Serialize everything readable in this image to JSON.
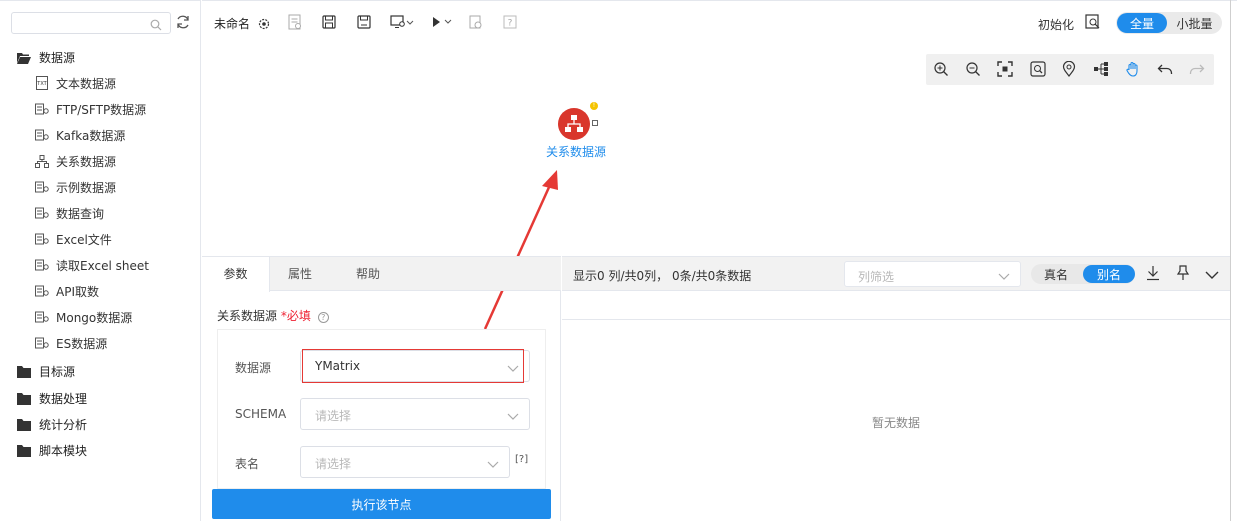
{
  "sidebar": {
    "search": {
      "placeholder": ""
    },
    "tree": {
      "datasource_group": "数据源",
      "datasource_items": [
        {
          "label": "文本数据源",
          "icon": "txt-file-icon"
        },
        {
          "label": "FTP/SFTP数据源",
          "icon": "database-link-icon"
        },
        {
          "label": "Kafka数据源",
          "icon": "database-link-icon"
        },
        {
          "label": "关系数据源",
          "icon": "relation-icon"
        },
        {
          "label": "示例数据源",
          "icon": "database-link-icon"
        },
        {
          "label": "数据查询",
          "icon": "database-link-icon"
        },
        {
          "label": "Excel文件",
          "icon": "database-link-icon"
        },
        {
          "label": "读取Excel sheet",
          "icon": "database-link-icon"
        },
        {
          "label": "API取数",
          "icon": "database-link-icon"
        },
        {
          "label": "Mongo数据源",
          "icon": "database-link-icon"
        },
        {
          "label": "ES数据源",
          "icon": "database-link-icon"
        }
      ],
      "other_groups": [
        "目标源",
        "数据处理",
        "统计分析",
        "脚本模块"
      ]
    }
  },
  "topbar": {
    "title": "未命名",
    "init_label": "初始化",
    "mode_full": "全量",
    "mode_small": "小批量"
  },
  "canvas": {
    "node_label": "关系数据源",
    "node_color": "#d9362c"
  },
  "param_panel": {
    "tabs": [
      "参数",
      "属性",
      "帮助"
    ],
    "section_title": "关系数据源",
    "required_mark": "*必填",
    "fields": {
      "datasource": {
        "label": "数据源",
        "value": "YMatrix"
      },
      "schema": {
        "label": "SCHEMA",
        "placeholder": "请选择"
      },
      "table": {
        "label": "表名",
        "placeholder": "请选择",
        "help": "[?]"
      }
    },
    "run_button": "执行该节点"
  },
  "data_panel": {
    "summary": "显示0 列/共0列， 0条/共0条数据",
    "column_filter_placeholder": "列筛选",
    "name_real": "真名",
    "name_alias": "别名",
    "empty_text": "暂无数据"
  },
  "colors": {
    "accent": "#1f8ceb",
    "highlight": "#e53935"
  }
}
